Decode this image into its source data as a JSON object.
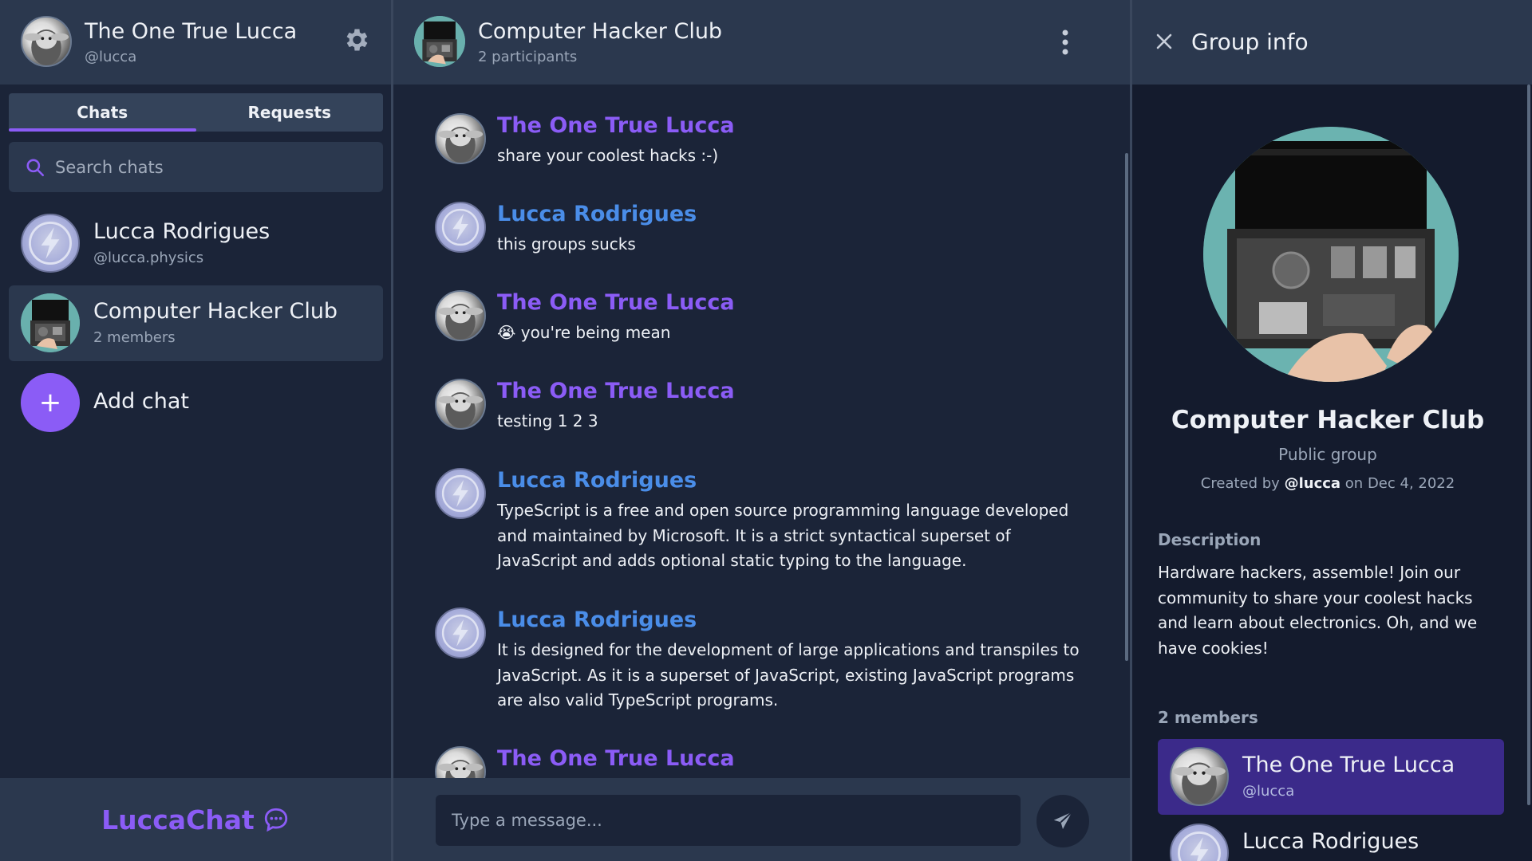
{
  "sidebar": {
    "user_name": "The One True Lucca",
    "user_handle": "@lucca",
    "tabs": [
      "Chats",
      "Requests"
    ],
    "search_placeholder": "Search chats",
    "chats": [
      {
        "name": "Lucca Rodrigues",
        "sub": "@lucca.physics"
      },
      {
        "name": "Computer Hacker Club",
        "sub": "2 members"
      }
    ],
    "add_chat_label": "Add chat",
    "brand": "LuccaChat"
  },
  "chat": {
    "title": "Computer Hacker Club",
    "subtitle": "2 participants",
    "composer_placeholder": "Type a message...",
    "messages": [
      {
        "author": "The One True Lucca",
        "text": "share your coolest hacks :-)"
      },
      {
        "author": "Lucca Rodrigues",
        "text": "this groups sucks"
      },
      {
        "author": "The One True Lucca",
        "text": "😭 you're being mean"
      },
      {
        "author": "The One True Lucca",
        "text": "testing 1 2 3"
      },
      {
        "author": "Lucca Rodrigues",
        "text": "TypeScript is a free and open source programming language developed and maintained by Microsoft. It is a strict syntactical superset of JavaScript and adds optional static typing to the language."
      },
      {
        "author": "Lucca Rodrigues",
        "text": "It is designed for the development of large applications and transpiles to JavaScript. As it is a superset of JavaScript, existing JavaScript programs are also valid TypeScript programs."
      },
      {
        "author": "The One True Lucca",
        "text": ""
      }
    ]
  },
  "info": {
    "header_title": "Group info",
    "group_name": "Computer Hacker Club",
    "group_type": "Public group",
    "created_prefix": "Created by",
    "created_by": "@lucca",
    "created_suffix": "on Dec 4, 2022",
    "description_label": "Description",
    "description": "Hardware hackers, assemble! Join our community to share your coolest hacks and learn about electronics. Oh, and we have cookies!",
    "members_label": "2 members",
    "members": [
      {
        "name": "The One True Lucca",
        "sub": "@lucca"
      },
      {
        "name": "Lucca Rodrigues",
        "sub": ""
      }
    ]
  },
  "colors": {
    "accent": "#8b5cf6",
    "blue_author": "#4a8de8",
    "highlight_member": "#3b2a8a"
  }
}
